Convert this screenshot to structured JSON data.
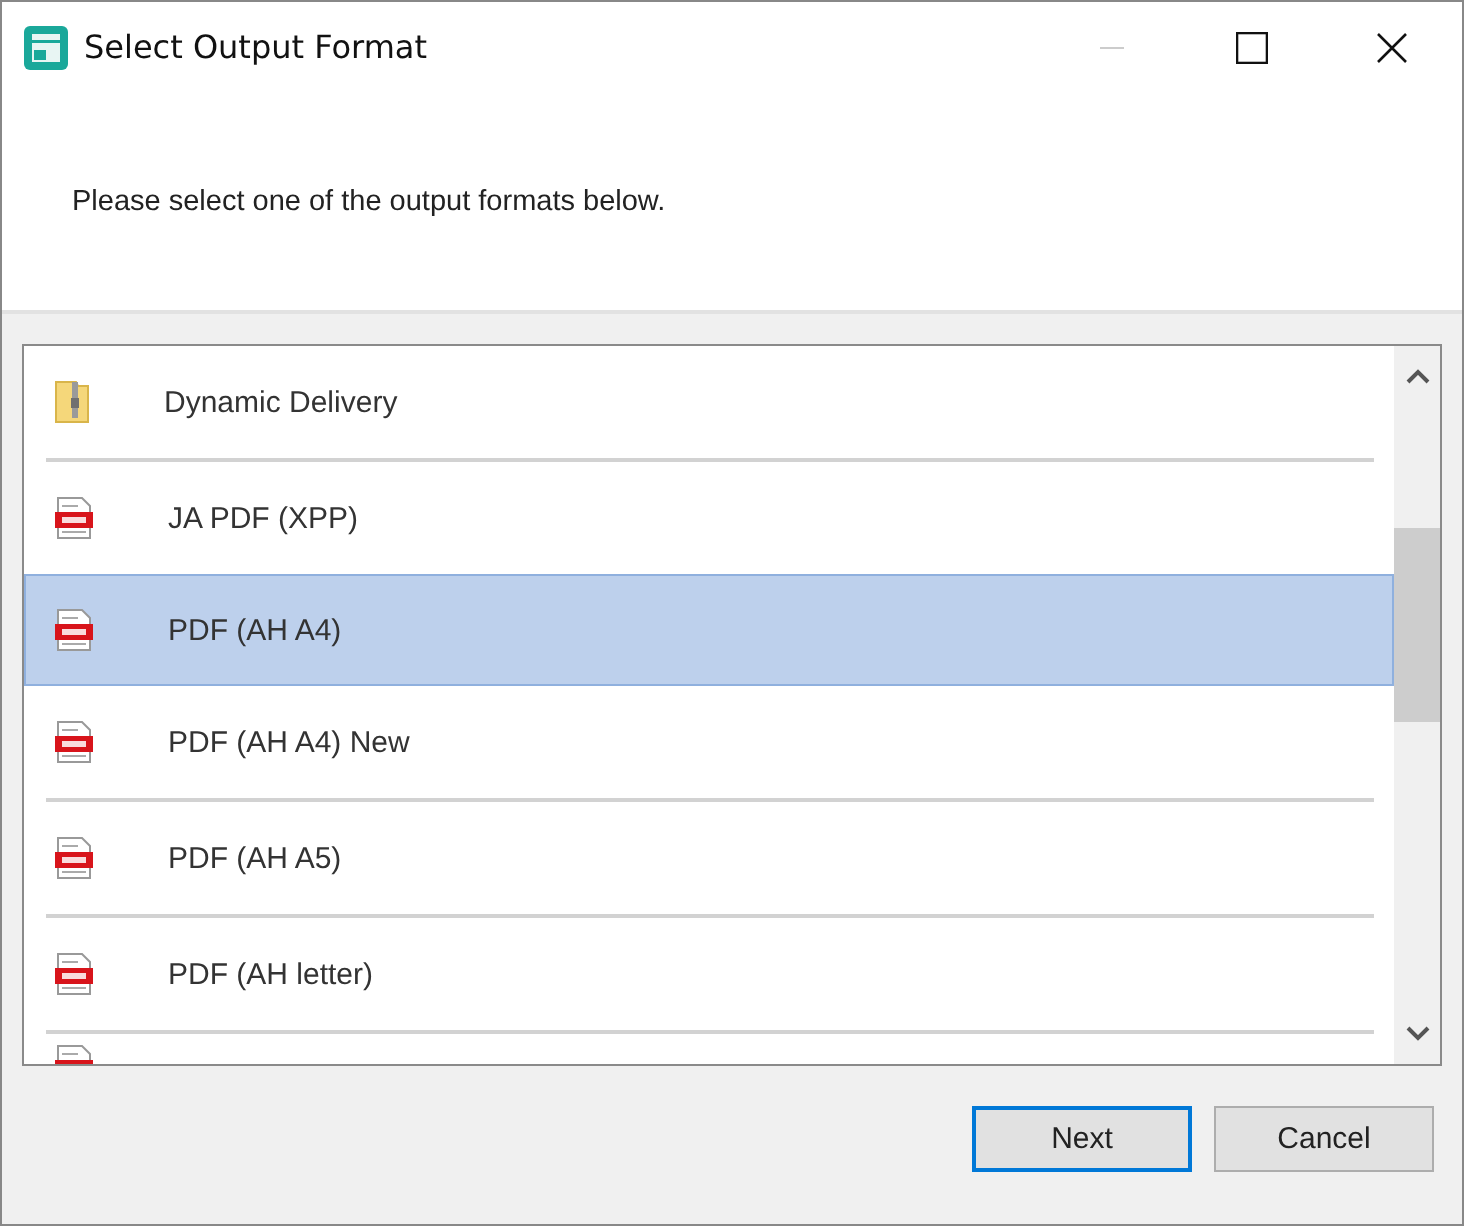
{
  "window": {
    "title": "Select Output Format"
  },
  "instruction": "Please select one of the output formats below.",
  "formats": [
    {
      "kind": "archive",
      "label": "Dynamic Delivery",
      "selected": false
    },
    {
      "kind": "pdf",
      "label": "JA PDF (XPP)",
      "selected": false
    },
    {
      "kind": "pdf",
      "label": "PDF (AH A4)",
      "selected": true
    },
    {
      "kind": "pdf",
      "label": "PDF (AH A4) New",
      "selected": false
    },
    {
      "kind": "pdf",
      "label": "PDF (AH A5)",
      "selected": false
    },
    {
      "kind": "pdf",
      "label": "PDF (AH letter)",
      "selected": false
    },
    {
      "kind": "pdf",
      "selected": false
    }
  ],
  "buttons": [
    {
      "label": "Next",
      "default": true
    },
    {
      "label": "Cancel",
      "default": false
    }
  ]
}
